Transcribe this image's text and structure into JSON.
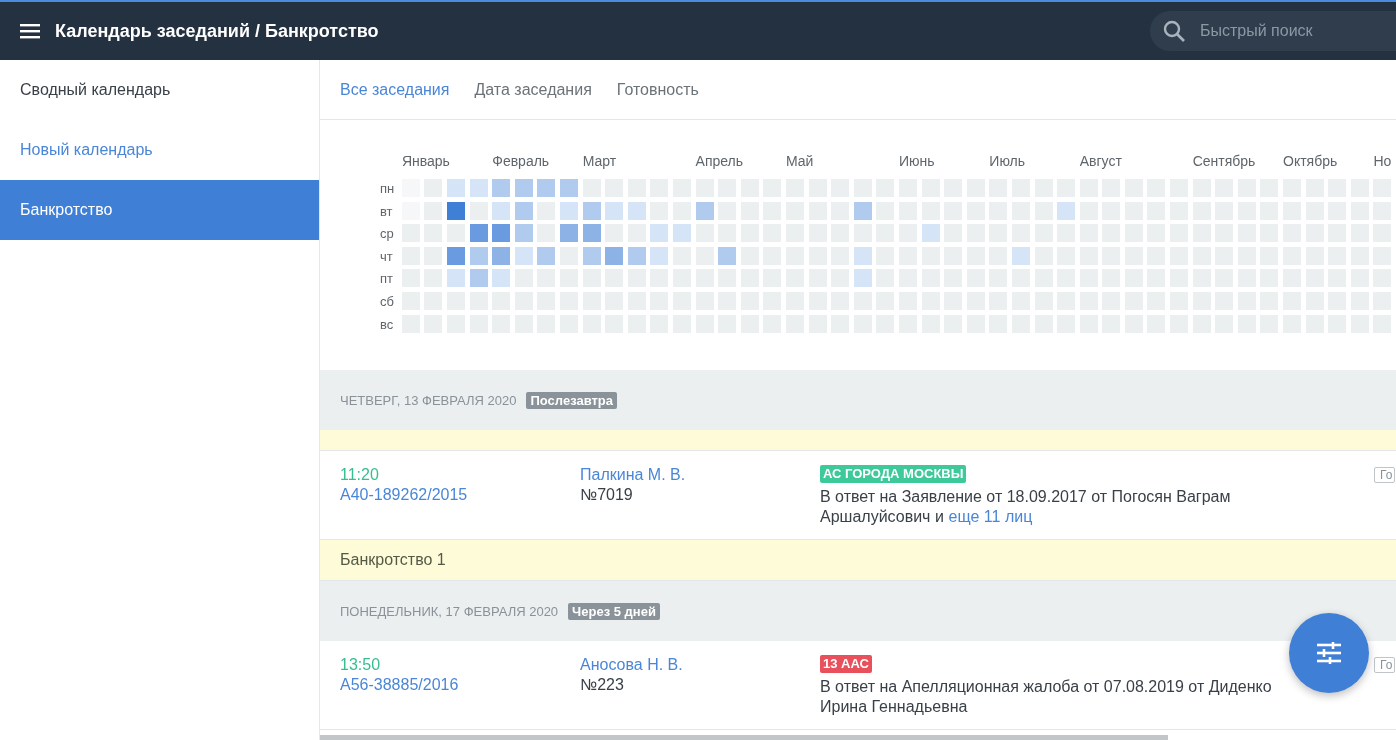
{
  "header": {
    "title": "Календарь заседаний / Банкротство",
    "search": {
      "placeholder": "Быстрый поиск"
    }
  },
  "sidebar": {
    "items": [
      {
        "label": "Сводный календарь",
        "kind": "item",
        "selected": false
      },
      {
        "label": "Новый календарь",
        "kind": "link",
        "selected": false
      },
      {
        "label": "Банкротство",
        "kind": "item",
        "selected": true
      }
    ]
  },
  "tabs": [
    {
      "label": "Все заседания",
      "selected": true
    },
    {
      "label": "Дата заседания",
      "selected": false
    },
    {
      "label": "Готовность",
      "selected": false
    }
  ],
  "heatmap": {
    "days": [
      "пн",
      "вт",
      "ср",
      "чт",
      "пт",
      "сб",
      "вс"
    ],
    "months": [
      {
        "label": "Январь",
        "weeks": [
          [
            {
              "color": "#f5f7f8"
            },
            {
              "color": "#f5f7f8"
            },
            {
              "color": "#ebeff0"
            },
            {
              "color": "#ebeff0"
            },
            {
              "color": "#ebeff0"
            },
            {
              "color": "#ebeff0"
            },
            {
              "color": "#ebeff0"
            }
          ],
          [
            {
              "color": "#ebeff0"
            },
            {
              "color": "#ebeff0"
            },
            {
              "color": "#ebeff0"
            },
            {
              "color": "#ebeff0"
            },
            {
              "color": "#ebeff0"
            },
            {
              "color": "#ebeff0"
            },
            {
              "color": "#ebeff0"
            }
          ],
          [
            {
              "color": "#d6e4f7"
            },
            {
              "color": "#3f7fd6"
            },
            {
              "color": "#ebeff0"
            },
            {
              "color": "#6a9be0"
            },
            {
              "color": "#d6e4f7"
            },
            {
              "color": "#ebeff0"
            },
            {
              "color": "#ebeff0"
            }
          ],
          [
            {
              "color": "#d6e4f7"
            },
            {
              "color": "#ebeff0"
            },
            {
              "color": "#6a9be0"
            },
            {
              "color": "#b0cbee"
            },
            {
              "color": "#b0cbee"
            },
            {
              "color": "#ebeff0"
            },
            {
              "color": "#ebeff0"
            }
          ]
        ]
      },
      {
        "label": "Февраль",
        "weeks": [
          [
            {
              "color": "#b0cbee"
            },
            {
              "color": "#d6e4f7"
            },
            {
              "color": "#6a9be0"
            },
            {
              "color": "#8db3e6"
            },
            {
              "color": "#d6e4f7"
            },
            {
              "color": "#ebeff0"
            },
            {
              "color": "#ebeff0"
            }
          ],
          [
            {
              "color": "#b0cbee"
            },
            {
              "color": "#b0cbee"
            },
            {
              "color": "#b0cbee"
            },
            {
              "color": "#d6e4f7"
            },
            {
              "color": "#ebeff0"
            },
            {
              "color": "#ebeff0"
            },
            {
              "color": "#ebeff0"
            }
          ],
          [
            {
              "color": "#b0cbee"
            },
            {
              "color": "#ebeff0"
            },
            {
              "color": "#ebeff0"
            },
            {
              "color": "#b0cbee"
            },
            {
              "color": "#ebeff0"
            },
            {
              "color": "#ebeff0"
            },
            {
              "color": "#ebeff0"
            }
          ],
          [
            {
              "color": "#b0cbee"
            },
            {
              "color": "#d6e4f7"
            },
            {
              "color": "#8db3e6"
            },
            {
              "color": "#ebeff0"
            },
            {
              "color": "#ebeff0"
            },
            {
              "color": "#ebeff0"
            },
            {
              "color": "#ebeff0"
            }
          ]
        ]
      },
      {
        "label": "Март",
        "weeks": [
          [
            {
              "color": "#ebeff0"
            },
            {
              "color": "#b0cbee"
            },
            {
              "color": "#8db3e6"
            },
            {
              "color": "#b0cbee"
            },
            {
              "color": "#ebeff0"
            },
            {
              "color": "#ebeff0"
            },
            {
              "color": "#ebeff0"
            }
          ],
          [
            {
              "color": "#ebeff0"
            },
            {
              "color": "#d6e4f7"
            },
            {
              "color": "#ebeff0"
            },
            {
              "color": "#8db3e6"
            },
            {
              "color": "#ebeff0"
            },
            {
              "color": "#ebeff0"
            },
            {
              "color": "#ebeff0"
            }
          ],
          [
            {
              "color": "#ebeff0"
            },
            {
              "color": "#d6e4f7"
            },
            {
              "color": "#ebeff0"
            },
            {
              "color": "#b0cbee"
            },
            {
              "color": "#ebeff0"
            },
            {
              "color": "#ebeff0"
            },
            {
              "color": "#ebeff0"
            }
          ],
          [
            {
              "color": "#ebeff0"
            },
            {
              "color": "#ebeff0"
            },
            {
              "color": "#d6e4f7"
            },
            {
              "color": "#d6e4f7"
            },
            {
              "color": "#ebeff0"
            },
            {
              "color": "#ebeff0"
            },
            {
              "color": "#ebeff0"
            }
          ],
          [
            {
              "color": "#ebeff0"
            },
            {
              "color": "#ebeff0"
            },
            {
              "color": "#d6e4f7"
            },
            {
              "color": "#ebeff0"
            },
            {
              "color": "#ebeff0"
            },
            {
              "color": "#ebeff0"
            },
            {
              "color": "#ebeff0"
            }
          ]
        ]
      },
      {
        "label": "Апрель",
        "weeks": [
          [
            {
              "color": "#ebeff0"
            },
            {
              "color": "#b0cbee"
            },
            {
              "color": "#ebeff0"
            },
            {
              "color": "#ebeff0"
            },
            {
              "color": "#ebeff0"
            },
            {
              "color": "#ebeff0"
            },
            {
              "color": "#ebeff0"
            }
          ],
          [
            {
              "color": "#ebeff0"
            },
            {
              "color": "#ebeff0"
            },
            {
              "color": "#ebeff0"
            },
            {
              "color": "#b0cbee"
            },
            {
              "color": "#ebeff0"
            },
            {
              "color": "#ebeff0"
            },
            {
              "color": "#ebeff0"
            }
          ],
          [
            {
              "color": "#ebeff0"
            },
            {
              "color": "#ebeff0"
            },
            {
              "color": "#ebeff0"
            },
            {
              "color": "#ebeff0"
            },
            {
              "color": "#ebeff0"
            },
            {
              "color": "#ebeff0"
            },
            {
              "color": "#ebeff0"
            }
          ],
          [
            {
              "color": "#ebeff0"
            },
            {
              "color": "#ebeff0"
            },
            {
              "color": "#ebeff0"
            },
            {
              "color": "#ebeff0"
            },
            {
              "color": "#ebeff0"
            },
            {
              "color": "#ebeff0"
            },
            {
              "color": "#ebeff0"
            }
          ]
        ]
      },
      {
        "label": "Май",
        "weeks": [
          [
            {
              "color": "#ebeff0"
            },
            {
              "color": "#ebeff0"
            },
            {
              "color": "#ebeff0"
            },
            {
              "color": "#ebeff0"
            },
            {
              "color": "#ebeff0"
            },
            {
              "color": "#ebeff0"
            },
            {
              "color": "#ebeff0"
            }
          ],
          [
            {
              "color": "#ebeff0"
            },
            {
              "color": "#ebeff0"
            },
            {
              "color": "#ebeff0"
            },
            {
              "color": "#ebeff0"
            },
            {
              "color": "#ebeff0"
            },
            {
              "color": "#ebeff0"
            },
            {
              "color": "#ebeff0"
            }
          ],
          [
            {
              "color": "#ebeff0"
            },
            {
              "color": "#ebeff0"
            },
            {
              "color": "#ebeff0"
            },
            {
              "color": "#ebeff0"
            },
            {
              "color": "#ebeff0"
            },
            {
              "color": "#ebeff0"
            },
            {
              "color": "#ebeff0"
            }
          ],
          [
            {
              "color": "#ebeff0"
            },
            {
              "color": "#b0cbee"
            },
            {
              "color": "#ebeff0"
            },
            {
              "color": "#d6e4f7"
            },
            {
              "color": "#d6e4f7"
            },
            {
              "color": "#ebeff0"
            },
            {
              "color": "#ebeff0"
            }
          ],
          [
            {
              "color": "#ebeff0"
            },
            {
              "color": "#ebeff0"
            },
            {
              "color": "#ebeff0"
            },
            {
              "color": "#ebeff0"
            },
            {
              "color": "#ebeff0"
            },
            {
              "color": "#ebeff0"
            },
            {
              "color": "#ebeff0"
            }
          ]
        ]
      },
      {
        "label": "Июнь",
        "weeks": [
          [
            {
              "color": "#ebeff0"
            },
            {
              "color": "#ebeff0"
            },
            {
              "color": "#ebeff0"
            },
            {
              "color": "#ebeff0"
            },
            {
              "color": "#ebeff0"
            },
            {
              "color": "#ebeff0"
            },
            {
              "color": "#ebeff0"
            }
          ],
          [
            {
              "color": "#ebeff0"
            },
            {
              "color": "#ebeff0"
            },
            {
              "color": "#d6e4f7"
            },
            {
              "color": "#ebeff0"
            },
            {
              "color": "#ebeff0"
            },
            {
              "color": "#ebeff0"
            },
            {
              "color": "#ebeff0"
            }
          ],
          [
            {
              "color": "#ebeff0"
            },
            {
              "color": "#ebeff0"
            },
            {
              "color": "#ebeff0"
            },
            {
              "color": "#ebeff0"
            },
            {
              "color": "#ebeff0"
            },
            {
              "color": "#ebeff0"
            },
            {
              "color": "#ebeff0"
            }
          ],
          [
            {
              "color": "#ebeff0"
            },
            {
              "color": "#ebeff0"
            },
            {
              "color": "#ebeff0"
            },
            {
              "color": "#ebeff0"
            },
            {
              "color": "#ebeff0"
            },
            {
              "color": "#ebeff0"
            },
            {
              "color": "#ebeff0"
            }
          ]
        ]
      },
      {
        "label": "Июль",
        "weeks": [
          [
            {
              "color": "#ebeff0"
            },
            {
              "color": "#ebeff0"
            },
            {
              "color": "#ebeff0"
            },
            {
              "color": "#ebeff0"
            },
            {
              "color": "#ebeff0"
            },
            {
              "color": "#ebeff0"
            },
            {
              "color": "#ebeff0"
            }
          ],
          [
            {
              "color": "#ebeff0"
            },
            {
              "color": "#ebeff0"
            },
            {
              "color": "#ebeff0"
            },
            {
              "color": "#d6e4f7"
            },
            {
              "color": "#ebeff0"
            },
            {
              "color": "#ebeff0"
            },
            {
              "color": "#ebeff0"
            }
          ],
          [
            {
              "color": "#ebeff0"
            },
            {
              "color": "#ebeff0"
            },
            {
              "color": "#ebeff0"
            },
            {
              "color": "#ebeff0"
            },
            {
              "color": "#ebeff0"
            },
            {
              "color": "#ebeff0"
            },
            {
              "color": "#ebeff0"
            }
          ],
          [
            {
              "color": "#ebeff0"
            },
            {
              "color": "#d6e4f7"
            },
            {
              "color": "#ebeff0"
            },
            {
              "color": "#ebeff0"
            },
            {
              "color": "#ebeff0"
            },
            {
              "color": "#ebeff0"
            },
            {
              "color": "#ebeff0"
            }
          ]
        ]
      },
      {
        "label": "Август",
        "weeks": [
          [
            {
              "color": "#ebeff0"
            },
            {
              "color": "#ebeff0"
            },
            {
              "color": "#ebeff0"
            },
            {
              "color": "#ebeff0"
            },
            {
              "color": "#ebeff0"
            },
            {
              "color": "#ebeff0"
            },
            {
              "color": "#ebeff0"
            }
          ],
          [
            {
              "color": "#ebeff0"
            },
            {
              "color": "#ebeff0"
            },
            {
              "color": "#ebeff0"
            },
            {
              "color": "#ebeff0"
            },
            {
              "color": "#ebeff0"
            },
            {
              "color": "#ebeff0"
            },
            {
              "color": "#ebeff0"
            }
          ],
          [
            {
              "color": "#ebeff0"
            },
            {
              "color": "#ebeff0"
            },
            {
              "color": "#ebeff0"
            },
            {
              "color": "#ebeff0"
            },
            {
              "color": "#ebeff0"
            },
            {
              "color": "#ebeff0"
            },
            {
              "color": "#ebeff0"
            }
          ],
          [
            {
              "color": "#ebeff0"
            },
            {
              "color": "#ebeff0"
            },
            {
              "color": "#ebeff0"
            },
            {
              "color": "#ebeff0"
            },
            {
              "color": "#ebeff0"
            },
            {
              "color": "#ebeff0"
            },
            {
              "color": "#ebeff0"
            }
          ],
          [
            {
              "color": "#ebeff0"
            },
            {
              "color": "#ebeff0"
            },
            {
              "color": "#ebeff0"
            },
            {
              "color": "#ebeff0"
            },
            {
              "color": "#ebeff0"
            },
            {
              "color": "#ebeff0"
            },
            {
              "color": "#ebeff0"
            }
          ]
        ]
      },
      {
        "label": "Сентябрь",
        "weeks": [
          [
            {
              "color": "#ebeff0"
            },
            {
              "color": "#ebeff0"
            },
            {
              "color": "#ebeff0"
            },
            {
              "color": "#ebeff0"
            },
            {
              "color": "#ebeff0"
            },
            {
              "color": "#ebeff0"
            },
            {
              "color": "#ebeff0"
            }
          ],
          [
            {
              "color": "#ebeff0"
            },
            {
              "color": "#ebeff0"
            },
            {
              "color": "#ebeff0"
            },
            {
              "color": "#ebeff0"
            },
            {
              "color": "#ebeff0"
            },
            {
              "color": "#ebeff0"
            },
            {
              "color": "#ebeff0"
            }
          ],
          [
            {
              "color": "#ebeff0"
            },
            {
              "color": "#ebeff0"
            },
            {
              "color": "#ebeff0"
            },
            {
              "color": "#ebeff0"
            },
            {
              "color": "#ebeff0"
            },
            {
              "color": "#ebeff0"
            },
            {
              "color": "#ebeff0"
            }
          ],
          [
            {
              "color": "#ebeff0"
            },
            {
              "color": "#ebeff0"
            },
            {
              "color": "#ebeff0"
            },
            {
              "color": "#ebeff0"
            },
            {
              "color": "#ebeff0"
            },
            {
              "color": "#ebeff0"
            },
            {
              "color": "#ebeff0"
            }
          ]
        ]
      },
      {
        "label": "Октябрь",
        "weeks": [
          [
            {
              "color": "#ebeff0"
            },
            {
              "color": "#ebeff0"
            },
            {
              "color": "#ebeff0"
            },
            {
              "color": "#ebeff0"
            },
            {
              "color": "#ebeff0"
            },
            {
              "color": "#ebeff0"
            },
            {
              "color": "#ebeff0"
            }
          ],
          [
            {
              "color": "#ebeff0"
            },
            {
              "color": "#ebeff0"
            },
            {
              "color": "#ebeff0"
            },
            {
              "color": "#ebeff0"
            },
            {
              "color": "#ebeff0"
            },
            {
              "color": "#ebeff0"
            },
            {
              "color": "#ebeff0"
            }
          ],
          [
            {
              "color": "#ebeff0"
            },
            {
              "color": "#ebeff0"
            },
            {
              "color": "#ebeff0"
            },
            {
              "color": "#ebeff0"
            },
            {
              "color": "#ebeff0"
            },
            {
              "color": "#ebeff0"
            },
            {
              "color": "#ebeff0"
            }
          ],
          [
            {
              "color": "#ebeff0"
            },
            {
              "color": "#ebeff0"
            },
            {
              "color": "#ebeff0"
            },
            {
              "color": "#ebeff0"
            },
            {
              "color": "#ebeff0"
            },
            {
              "color": "#ebeff0"
            },
            {
              "color": "#ebeff0"
            }
          ]
        ]
      },
      {
        "label": "Но",
        "weeks": [
          [
            {
              "color": "#ebeff0"
            },
            {
              "color": "#ebeff0"
            },
            {
              "color": "#ebeff0"
            },
            {
              "color": "#ebeff0"
            },
            {
              "color": "#ebeff0"
            },
            {
              "color": "#ebeff0"
            },
            {
              "color": "#ebeff0"
            }
          ]
        ]
      }
    ]
  },
  "agenda": [
    {
      "kind": "date",
      "date": "ЧЕТВЕРГ, 13 ФЕВРАЛЯ 2020",
      "badge": "Послезавтра"
    },
    {
      "kind": "strip"
    },
    {
      "kind": "session",
      "time": "11:20",
      "case": "А40-189262/2015",
      "judge": "Палкина М. В.",
      "number": "№7019",
      "court": {
        "label": "АС ГОРОДА МОСКВЫ",
        "color": "#3ec99a"
      },
      "text": "В ответ на Заявление от 18.09.2017 от Погосян Ваграм Аршалуйсович и",
      "link": "еще 11 лиц",
      "status": "Го"
    },
    {
      "kind": "group",
      "label": "Банкротство 1"
    },
    {
      "kind": "date",
      "date": "ПОНЕДЕЛЬНИК, 17 ФЕВРАЛЯ 2020",
      "badge": "Через 5 дней"
    },
    {
      "kind": "session",
      "time": "13:50",
      "case": "А56-38885/2016",
      "judge": "Аносова Н. В.",
      "number": "№223",
      "court": {
        "label": "13 ААС",
        "color": "#e8505b"
      },
      "text": "В ответ на Апелляционная жалоба от 07.08.2019 от Диденко Ирина Геннадьевна",
      "status": "Го"
    }
  ]
}
